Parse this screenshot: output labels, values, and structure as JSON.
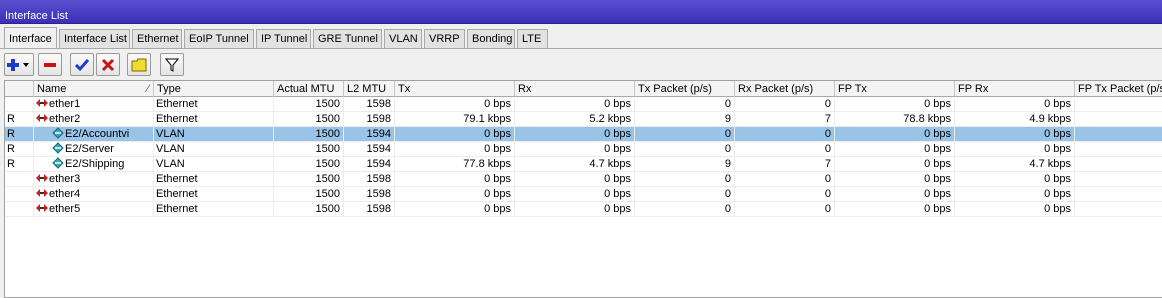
{
  "window": {
    "title": "Interface List"
  },
  "tabs": [
    "Interface",
    "Interface List",
    "Ethernet",
    "EoIP Tunnel",
    "IP Tunnel",
    "GRE Tunnel",
    "VLAN",
    "VRRP",
    "Bonding",
    "LTE"
  ],
  "toolbar": {
    "add": {
      "icon": "plus-icon",
      "color": "#1a3cc8"
    },
    "remove": {
      "icon": "minus-icon",
      "color": "#c81414"
    },
    "enable": {
      "icon": "checkmark-icon",
      "color": "#1a3cc8"
    },
    "disable": {
      "icon": "x-mark-icon",
      "color": "#c81414"
    },
    "comment": {
      "icon": "comment-icon",
      "color": "#e8c800"
    },
    "filter": {
      "icon": "filter-icon"
    }
  },
  "columns": [
    "",
    "Name",
    "Type",
    "Actual MTU",
    "L2 MTU",
    "Tx",
    "Rx",
    "Tx Packet (p/s)",
    "Rx Packet (p/s)",
    "FP Tx",
    "FP Rx",
    "FP Tx Packet (p/s"
  ],
  "rows": [
    {
      "flag": "",
      "name": "ether1",
      "kind": "ethernet",
      "type": "Ethernet",
      "mtu": "1500",
      "l2mtu": "1598",
      "tx": "0 bps",
      "rx": "0 bps",
      "txp": "0",
      "rxp": "0",
      "fptx": "0 bps",
      "fprx": "0 bps",
      "selected": false
    },
    {
      "flag": "R",
      "name": "ether2",
      "kind": "ethernet",
      "type": "Ethernet",
      "mtu": "1500",
      "l2mtu": "1598",
      "tx": "79.1 kbps",
      "rx": "5.2 kbps",
      "txp": "9",
      "rxp": "7",
      "fptx": "78.8 kbps",
      "fprx": "4.9 kbps",
      "selected": false
    },
    {
      "flag": "R",
      "name": "E2/Accountvi",
      "kind": "vlan",
      "type": "VLAN",
      "mtu": "1500",
      "l2mtu": "1594",
      "tx": "0 bps",
      "rx": "0 bps",
      "txp": "0",
      "rxp": "0",
      "fptx": "0 bps",
      "fprx": "0 bps",
      "selected": true
    },
    {
      "flag": "R",
      "name": "E2/Server",
      "kind": "vlan",
      "type": "VLAN",
      "mtu": "1500",
      "l2mtu": "1594",
      "tx": "0 bps",
      "rx": "0 bps",
      "txp": "0",
      "rxp": "0",
      "fptx": "0 bps",
      "fprx": "0 bps",
      "selected": false
    },
    {
      "flag": "R",
      "name": "E2/Shipping",
      "kind": "vlan",
      "type": "VLAN",
      "mtu": "1500",
      "l2mtu": "1594",
      "tx": "77.8 kbps",
      "rx": "4.7 kbps",
      "txp": "9",
      "rxp": "7",
      "fptx": "0 bps",
      "fprx": "4.7 kbps",
      "selected": false
    },
    {
      "flag": "",
      "name": "ether3",
      "kind": "ethernet",
      "type": "Ethernet",
      "mtu": "1500",
      "l2mtu": "1598",
      "tx": "0 bps",
      "rx": "0 bps",
      "txp": "0",
      "rxp": "0",
      "fptx": "0 bps",
      "fprx": "0 bps",
      "selected": false
    },
    {
      "flag": "",
      "name": "ether4",
      "kind": "ethernet",
      "type": "Ethernet",
      "mtu": "1500",
      "l2mtu": "1598",
      "tx": "0 bps",
      "rx": "0 bps",
      "txp": "0",
      "rxp": "0",
      "fptx": "0 bps",
      "fprx": "0 bps",
      "selected": false
    },
    {
      "flag": "",
      "name": "ether5",
      "kind": "ethernet",
      "type": "Ethernet",
      "mtu": "1500",
      "l2mtu": "1598",
      "tx": "0 bps",
      "rx": "0 bps",
      "txp": "0",
      "rxp": "0",
      "fptx": "0 bps",
      "fprx": "0 bps",
      "selected": false
    }
  ],
  "colors": {
    "titlebar": "#4a40c8",
    "selection": "#99c4e8"
  }
}
